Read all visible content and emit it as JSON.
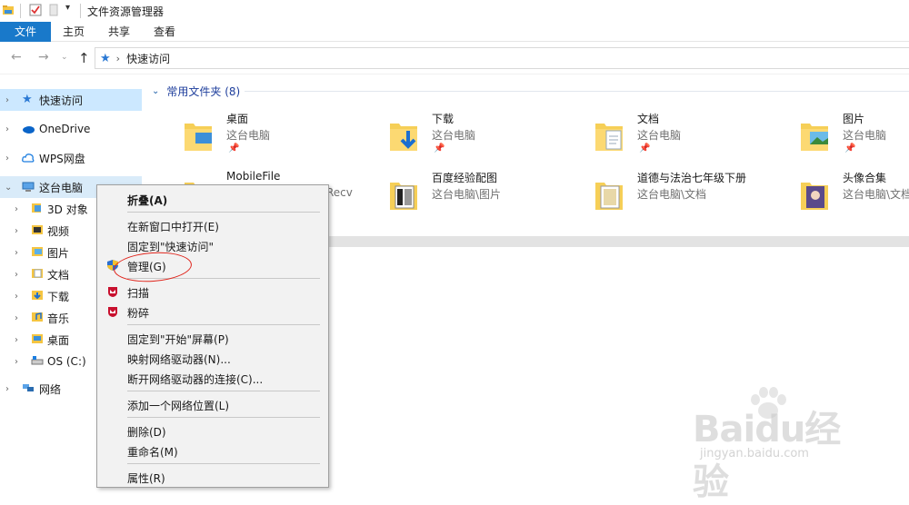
{
  "window": {
    "title": "文件资源管理器"
  },
  "ribbon": {
    "tabs": [
      "文件",
      "主页",
      "共享",
      "查看"
    ]
  },
  "address": {
    "crumb": "快速访问"
  },
  "sidebar": {
    "items": [
      {
        "label": "快速访问"
      },
      {
        "label": "OneDrive"
      },
      {
        "label": "WPS网盘"
      },
      {
        "label": "这台电脑"
      },
      {
        "label": "3D 对象"
      },
      {
        "label": "视频"
      },
      {
        "label": "图片"
      },
      {
        "label": "文档"
      },
      {
        "label": "下载"
      },
      {
        "label": "音乐"
      },
      {
        "label": "桌面"
      },
      {
        "label": "OS (C:)"
      },
      {
        "label": "网络"
      }
    ]
  },
  "content": {
    "group_label": "常用文件夹 (8)",
    "folders": [
      {
        "name": "桌面",
        "location": "这台电脑",
        "pinned": true
      },
      {
        "name": "下载",
        "location": "这台电脑",
        "pinned": true
      },
      {
        "name": "文档",
        "location": "这台电脑",
        "pinned": true
      },
      {
        "name": "图片",
        "location": "这台电脑",
        "pinned": true
      },
      {
        "name": "MobileFile",
        "location": "Recv"
      },
      {
        "name": "百度经验配图",
        "location": "这台电脑\\图片"
      },
      {
        "name": "道德与法治七年级下册",
        "location": "这台电脑\\文档"
      },
      {
        "name": "头像合集",
        "location": "这台电脑\\文档"
      }
    ]
  },
  "context_menu": {
    "items": [
      {
        "label": "折叠(A)"
      },
      {
        "label": "在新窗口中打开(E)"
      },
      {
        "label": "固定到\"快速访问\""
      },
      {
        "label": "管理(G)"
      },
      {
        "label": "扫描"
      },
      {
        "label": "粉碎"
      },
      {
        "label": "固定到\"开始\"屏幕(P)"
      },
      {
        "label": "映射网络驱动器(N)..."
      },
      {
        "label": "断开网络驱动器的连接(C)..."
      },
      {
        "label": "添加一个网络位置(L)"
      },
      {
        "label": "删除(D)"
      },
      {
        "label": "重命名(M)"
      },
      {
        "label": "属性(R)"
      }
    ]
  },
  "watermark": {
    "main": "Baidu经验",
    "sub": "jingyan.baidu.com"
  },
  "colors": {
    "accent": "#1979ca",
    "selection": "#cce8ff",
    "annotation": "#e0241b"
  }
}
